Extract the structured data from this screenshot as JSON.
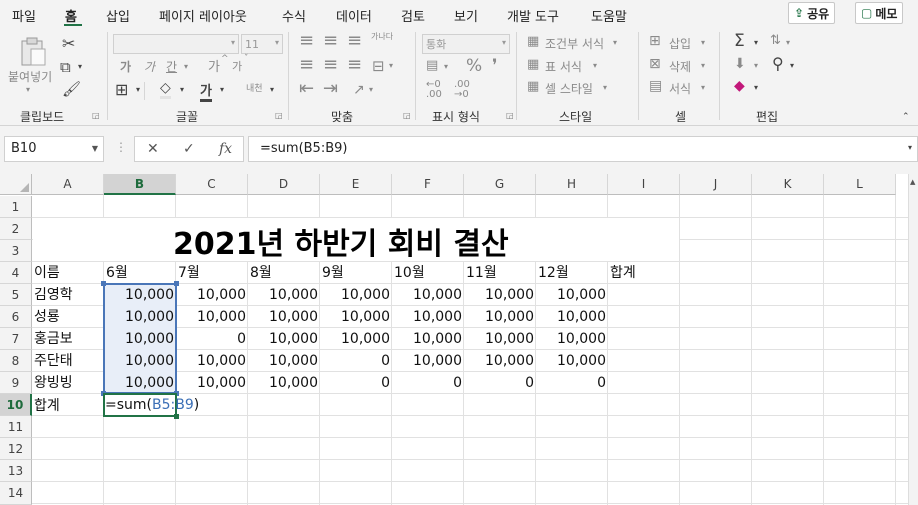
{
  "menu": {
    "tabs": [
      "파일",
      "홈",
      "삽입",
      "페이지 레이아웃",
      "수식",
      "데이터",
      "검토",
      "보기",
      "개발 도구",
      "도움말"
    ],
    "active_tab": "홈",
    "share_label": "공유",
    "memo_label": "메모"
  },
  "ribbon": {
    "clipboard": {
      "label": "클립보드",
      "paste_label": "붙여넣기"
    },
    "font": {
      "label": "글꼴",
      "font_name": "",
      "font_size": "11",
      "bold": "가",
      "italic": "가",
      "underline": "간",
      "grow": "가",
      "shrink": "가",
      "phonetic": "내천"
    },
    "alignment": {
      "label": "맞춤",
      "wrap": "가나다"
    },
    "number": {
      "label": "표시 형식",
      "format": "통화",
      "percent": "%"
    },
    "styles": {
      "label": "스타일",
      "conditional": "조건부 서식",
      "table": "표 서식",
      "cell_styles": "셀 스타일"
    },
    "cells": {
      "label": "셀",
      "insert": "삽입",
      "delete": "삭제",
      "format": "서식"
    },
    "editing": {
      "label": "편집"
    }
  },
  "formula_bar": {
    "name_box": "B10",
    "formula": "=sum(B5:B9)"
  },
  "sheet": {
    "columns": [
      "A",
      "B",
      "C",
      "D",
      "E",
      "F",
      "G",
      "H",
      "I",
      "J",
      "K",
      "L"
    ],
    "selected_column": "B",
    "rows": [
      "1",
      "2",
      "3",
      "4",
      "5",
      "6",
      "7",
      "8",
      "9",
      "10",
      "11",
      "12",
      "13",
      "14"
    ],
    "selected_row": "10",
    "title": "2021년 하반기 회비 결산",
    "header_row": [
      "이름",
      "6월",
      "7월",
      "8월",
      "9월",
      "10월",
      "11월",
      "12월",
      "합계"
    ],
    "data_rows": [
      {
        "name": "김영학",
        "values": [
          "10,000",
          "10,000",
          "10,000",
          "10,000",
          "10,000",
          "10,000",
          "10,000"
        ]
      },
      {
        "name": "성룡",
        "values": [
          "10,000",
          "10,000",
          "10,000",
          "10,000",
          "10,000",
          "10,000",
          "10,000"
        ]
      },
      {
        "name": "홍금보",
        "values": [
          "10,000",
          "0",
          "10,000",
          "10,000",
          "10,000",
          "10,000",
          "10,000"
        ]
      },
      {
        "name": "주단태",
        "values": [
          "10,000",
          "10,000",
          "10,000",
          "0",
          "10,000",
          "10,000",
          "10,000"
        ]
      },
      {
        "name": "왕빙빙",
        "values": [
          "10,000",
          "10,000",
          "10,000",
          "0",
          "0",
          "0",
          "0"
        ]
      }
    ],
    "total_label": "합계",
    "edit_cell": {
      "prefix": "=sum(",
      "ref": "B5:B9",
      "suffix": ")"
    }
  }
}
